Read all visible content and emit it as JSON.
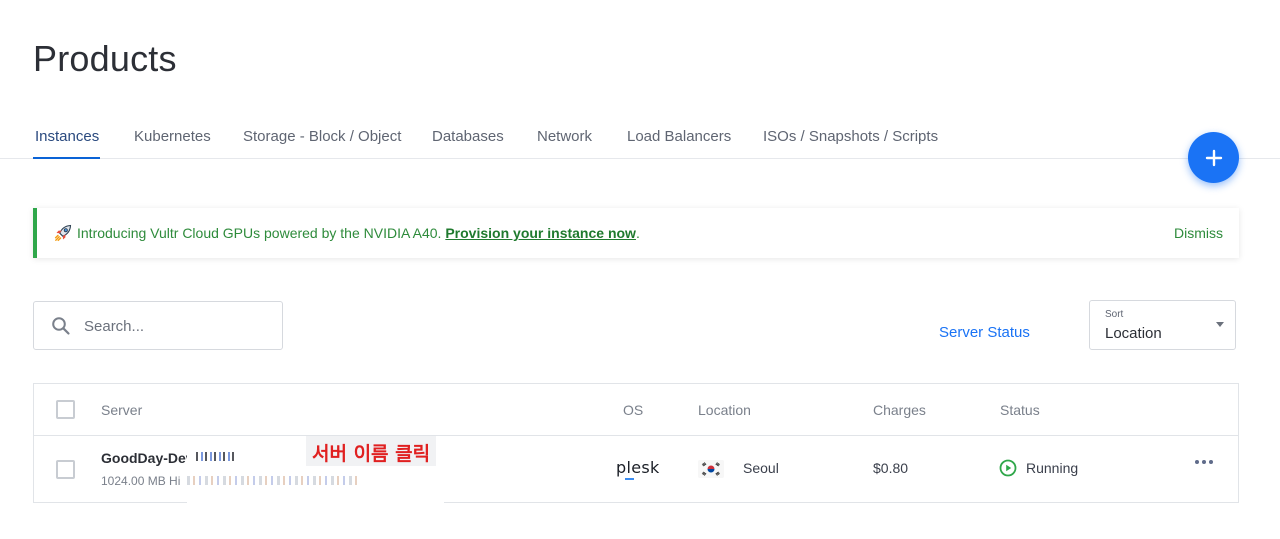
{
  "page": {
    "title": "Products"
  },
  "tabs": [
    {
      "label": "Instances",
      "active": true
    },
    {
      "label": "Kubernetes"
    },
    {
      "label": "Storage - Block / Object"
    },
    {
      "label": "Databases"
    },
    {
      "label": "Network"
    },
    {
      "label": "Load Balancers"
    },
    {
      "label": "ISOs / Snapshots / Scripts"
    }
  ],
  "fab": {
    "icon": "plus-icon",
    "color": "#1a73f5"
  },
  "banner": {
    "icon": "rocket-icon",
    "text": "Introducing Vultr Cloud GPUs powered by the NVIDIA A40.",
    "link": "Provision your instance now",
    "suffix": ".",
    "dismiss": "Dismiss",
    "accent": "#2fa74a"
  },
  "search": {
    "placeholder": "Search...",
    "value": ""
  },
  "server_status_label": "Server Status",
  "sort": {
    "label": "Sort",
    "value": "Location"
  },
  "table": {
    "columns": [
      "Server",
      "OS",
      "Location",
      "Charges",
      "Status"
    ],
    "rows": [
      {
        "name": "GoodDay-Dev",
        "sub": "1024.00 MB Hi",
        "annotation": "서버 이름 클릭",
        "os": "plesk",
        "location": "Seoul",
        "flag": "south-korea-flag",
        "charges": "$0.80",
        "status": "Running",
        "status_color": "#2fa74a"
      }
    ]
  }
}
